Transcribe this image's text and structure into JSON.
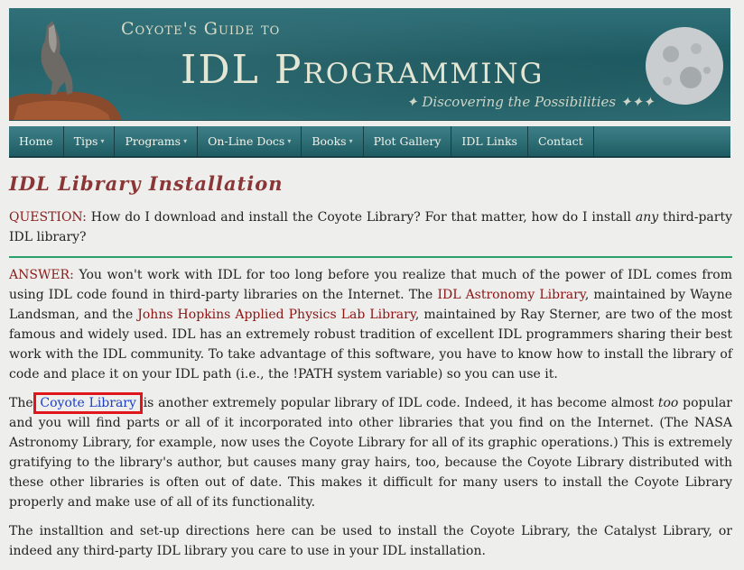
{
  "banner": {
    "top_line": "Coyote's Guide to",
    "title": "IDL Programming",
    "tagline": "✦ Discovering the Possibilities ✦✦✦"
  },
  "nav": {
    "items": [
      {
        "label": "Home",
        "has_dropdown": false
      },
      {
        "label": "Tips",
        "has_dropdown": true
      },
      {
        "label": "Programs",
        "has_dropdown": true
      },
      {
        "label": "On-Line Docs",
        "has_dropdown": true
      },
      {
        "label": "Books",
        "has_dropdown": true
      },
      {
        "label": "Plot Gallery",
        "has_dropdown": false
      },
      {
        "label": "IDL Links",
        "has_dropdown": false
      },
      {
        "label": "Contact",
        "has_dropdown": false
      }
    ]
  },
  "page": {
    "title": "IDL Library Installation",
    "question_label": "QUESTION:",
    "question_text_1": "How do I download and install the Coyote Library? For that matter, how do I install ",
    "question_emph": "any",
    "question_text_2": " third-party IDL library?",
    "answer_label": "ANSWER:",
    "answer_text_1": "You won't work with IDL for too long before you realize that much of the power of IDL comes from using IDL code found in third-party libraries on the Internet. The ",
    "link_astronomy": "IDL Astronomy Library",
    "answer_text_2": ", maintained by Wayne Landsman, and the ",
    "link_jhu": "Johns Hopkins Applied Physics Lab Library",
    "answer_text_3": ", maintained by Ray Sterner, are two of the most famous and widely used. IDL has an extremely robust tradition of excellent IDL programmers sharing their best work with the IDL community. To take advantage of this software, you have to know how to install the library of code and place it on your IDL path (i.e., the !PATH system variable) so you can use it.",
    "p2_text_1": "The ",
    "link_coyote": "Coyote Library",
    "p2_text_2": " is another extremely popular library of IDL code. Indeed, it has become almost ",
    "p2_emph": "too",
    "p2_text_3": " popular and you will find parts or all of it incorporated into other libraries that you find on the Internet. (The NASA Astronomy Library, for example, now uses the Coyote Library for all of its graphic operations.) This is extremely gratifying to the library's author, but causes many gray hairs, too, because the Coyote Library distributed with these other libraries is often out of date. This makes it difficult for many users to install the Coyote Library properly and make use of all of its functionality.",
    "p3_text": "The installtion and set-up directions here can be used to install the Coyote Library, the Catalyst Library, or indeed any third-party IDL library you care to use in your IDL installation."
  },
  "colors": {
    "banner": "#1f5e66",
    "title": "#8b3636",
    "label_red": "#8b1c1c",
    "link_blue": "#1a3fc7",
    "divider": "#2aa06a",
    "highlight": "#e0161c"
  }
}
